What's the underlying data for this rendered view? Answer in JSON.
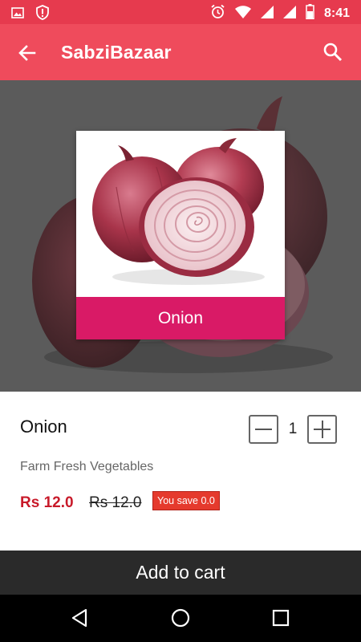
{
  "status_bar": {
    "time": "8:41",
    "icons": [
      "image-icon",
      "alert-shield-icon",
      "alarm-icon",
      "wifi-icon",
      "signal-icon",
      "signal-icon",
      "battery-icon"
    ]
  },
  "app_bar": {
    "title": "SabziBazaar",
    "back_icon": "arrow-back-icon",
    "search_icon": "search-icon"
  },
  "hero": {
    "card_label": "Onion"
  },
  "product": {
    "name": "Onion",
    "subtitle": "Farm Fresh Vegetables",
    "price": "Rs 12.0",
    "old_price": "Rs 12.0",
    "save_text": "You save 0.0",
    "quantity": "1"
  },
  "cart": {
    "button_label": "Add to cart"
  },
  "colors": {
    "status_bar": "#e63a4e",
    "app_bar": "#ef4b5c",
    "card_label_bg": "#d91a66",
    "price": "#c81a2a",
    "save_badge": "#e53a2d",
    "cart_button": "#2a2a2a"
  }
}
